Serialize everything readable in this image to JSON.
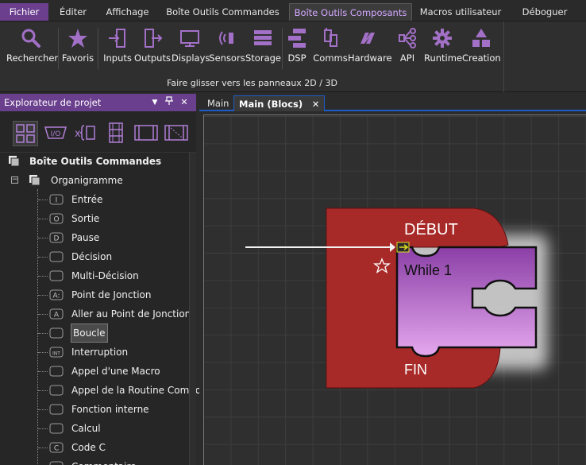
{
  "menubar": {
    "items": [
      {
        "label": "Fichier"
      },
      {
        "label": "Éditer"
      },
      {
        "label": "Affichage"
      },
      {
        "label": "Boîte Outils Commandes"
      },
      {
        "label": "Boîte Outils Composants"
      },
      {
        "label": "Macros utilisateur"
      },
      {
        "label": "Déboguer"
      }
    ]
  },
  "ribbon": {
    "buttons": [
      {
        "label": "Rechercher",
        "icon": "search-icon"
      },
      {
        "label": "Favoris",
        "icon": "star-icon"
      },
      {
        "label": "Inputs",
        "icon": "inputs-icon"
      },
      {
        "label": "Outputs",
        "icon": "outputs-icon"
      },
      {
        "label": "Displays",
        "icon": "display-icon"
      },
      {
        "label": "Sensors",
        "icon": "sensor-icon"
      },
      {
        "label": "Storage",
        "icon": "storage-icon"
      },
      {
        "label": "DSP",
        "icon": "dsp-icon"
      },
      {
        "label": "Comms",
        "icon": "comms-icon"
      },
      {
        "label": "Hardware",
        "icon": "hardware-icon"
      },
      {
        "label": "API",
        "icon": "api-icon"
      },
      {
        "label": "Runtime",
        "icon": "gear-icon"
      },
      {
        "label": "Creation",
        "icon": "shapes-icon"
      }
    ],
    "caption": "Faire glisser vers les panneaux 2D / 3D",
    "accent": "#a370c8"
  },
  "explorer": {
    "title": "Explorateur de projet",
    "header_buttons": {
      "dropdown": "▼",
      "pin": "📌",
      "close": "✕"
    },
    "header_color": "#6a3f8d",
    "tree": {
      "root": "Boîte Outils Commandes",
      "group": "Organigramme",
      "items": [
        {
          "label": "Entrée",
          "glyph": "I"
        },
        {
          "label": "Sortie",
          "glyph": "O"
        },
        {
          "label": "Pause",
          "glyph": "D"
        },
        {
          "label": "Décision",
          "glyph": ""
        },
        {
          "label": "Multi-Décision",
          "glyph": ""
        },
        {
          "label": "Point de Jonction",
          "glyph": "A:"
        },
        {
          "label": "Aller au Point de Jonction",
          "glyph": "A"
        },
        {
          "label": "Boucle",
          "glyph": ""
        },
        {
          "label": "Interruption",
          "glyph": "INT"
        },
        {
          "label": "Appel d'une Macro",
          "glyph": ""
        },
        {
          "label": "Appel de la Routine Compo",
          "glyph": ""
        },
        {
          "label": "Fonction interne",
          "glyph": ""
        },
        {
          "label": "Calcul",
          "glyph": ""
        },
        {
          "label": "Code C",
          "glyph": "C"
        },
        {
          "label": "Commentaire",
          "glyph": ""
        }
      ],
      "selected": "Boucle"
    }
  },
  "editor": {
    "tabs": [
      {
        "label": "Main"
      },
      {
        "label": "Main (Blocs)",
        "close": "✕"
      }
    ],
    "blocks": {
      "start_label": "DÉBUT",
      "loop_label": "While 1",
      "end_label": "FIN",
      "start_color": "#a82a28",
      "loop_color_top": "#8a3fa6",
      "loop_color_bottom": "#e5a8ee"
    }
  }
}
